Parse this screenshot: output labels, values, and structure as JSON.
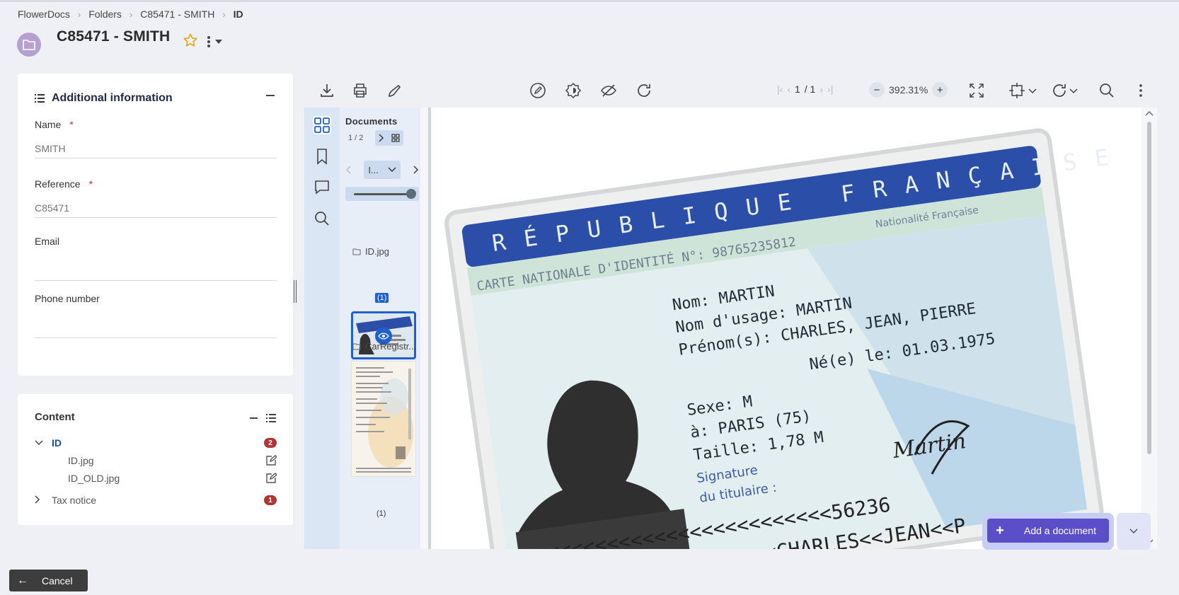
{
  "breadcrumb": [
    {
      "label": "FlowerDocs"
    },
    {
      "label": "Folders"
    },
    {
      "label": "C85471 - SMITH"
    },
    {
      "label": "ID"
    }
  ],
  "header": {
    "title": "C85471 - SMITH"
  },
  "info_panel": {
    "title": "Additional information",
    "fields": {
      "name": {
        "label": "Name",
        "required": "*",
        "value": "SMITH"
      },
      "reference": {
        "label": "Reference",
        "required": "*",
        "value": "C85471"
      },
      "email": {
        "label": "Email",
        "value": ""
      },
      "phone": {
        "label": "Phone number",
        "value": ""
      }
    }
  },
  "content_panel": {
    "title": "Content",
    "folders": [
      {
        "label": "ID",
        "count": "2",
        "files": [
          "ID.jpg",
          "ID_OLD.jpg"
        ]
      },
      {
        "label": "Tax notice",
        "count": "1"
      }
    ]
  },
  "viewer": {
    "page_current": "1",
    "page_total": "/ 1",
    "zoom": "392.31%",
    "thumbs": {
      "title": "Documents",
      "count": "1 / 2",
      "selector": "I...",
      "docs": [
        {
          "name": "ID.jpg",
          "page": "(1)"
        },
        {
          "name": "CarRegistr...",
          "page": "(1)"
        }
      ]
    },
    "id_card": {
      "header": "RÉPUBLIQUE FRANÇAISE",
      "nationality": "Nationalité Française",
      "card_line": "CARTE NATIONALE D'IDENTITÉ N°: 98765235812",
      "nom": "Nom: MARTIN",
      "nom_usage": "Nom d'usage: MARTIN",
      "prenoms": "Prénom(s): CHARLES, JEAN, PIERRE",
      "born": "Né(e) le: 01.03.1975",
      "sexe": "Sexe: M",
      "place": "à: PARIS (75)",
      "taille": "Taille: 1,78 M",
      "sig1": "Signature",
      "sig2": "du titulaire :",
      "signature": "Martin",
      "mrz1": "<<<<<<<<<<<<<<<<<<<<<<<<<56236",
      "mrz2": "MARTIN<<<<<<<<<<<<<<CHARLES<<JEAN<<P"
    }
  },
  "actions": {
    "add_document": "Add a document",
    "cancel": "Cancel"
  },
  "colors": {
    "accent": "#5a4fc9",
    "badge": "#b03535",
    "active_link": "#1c4f9c",
    "card_blue": "#2b4fa8"
  }
}
